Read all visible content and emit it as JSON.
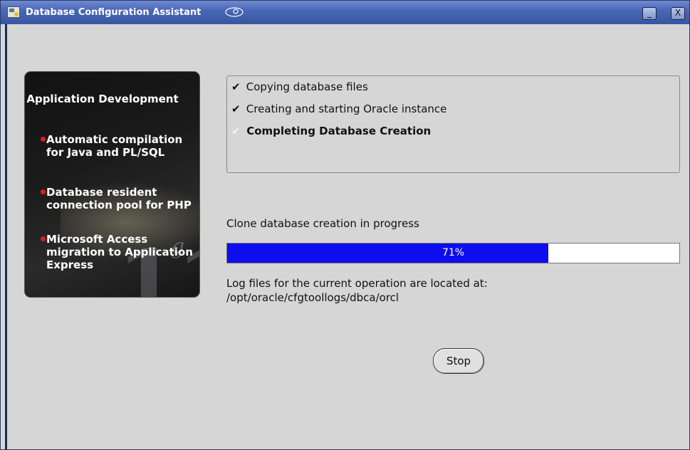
{
  "window": {
    "title": "Database Configuration Assistant",
    "minimize_label": "_",
    "close_label": "X"
  },
  "banner": {
    "heading": "Application Development",
    "bullets": [
      "Automatic compilation for Java and PL/SQL",
      "Database resident connection pool for PHP",
      "Microsoft Access migration to Application Express"
    ],
    "badge_number": "11",
    "badge_letter": "g",
    "colors": {
      "bullet_dot": "#e21b1b",
      "background": "#121212"
    }
  },
  "steps": [
    {
      "label": "Copying database files",
      "mark": "✔",
      "state": "done"
    },
    {
      "label": "Creating and starting Oracle instance",
      "mark": "✔",
      "state": "done"
    },
    {
      "label": "Completing Database Creation",
      "mark": "✔",
      "state": "in-progress"
    }
  ],
  "status_text": "Clone database creation in progress",
  "progress": {
    "percent": 71,
    "label": "71%",
    "fill_color": "#0d0dee"
  },
  "log": {
    "line1": "Log files for the current operation are located at:",
    "line2": "/opt/oracle/cfgtoollogs/dbca/orcl"
  },
  "stop_button": "Stop"
}
